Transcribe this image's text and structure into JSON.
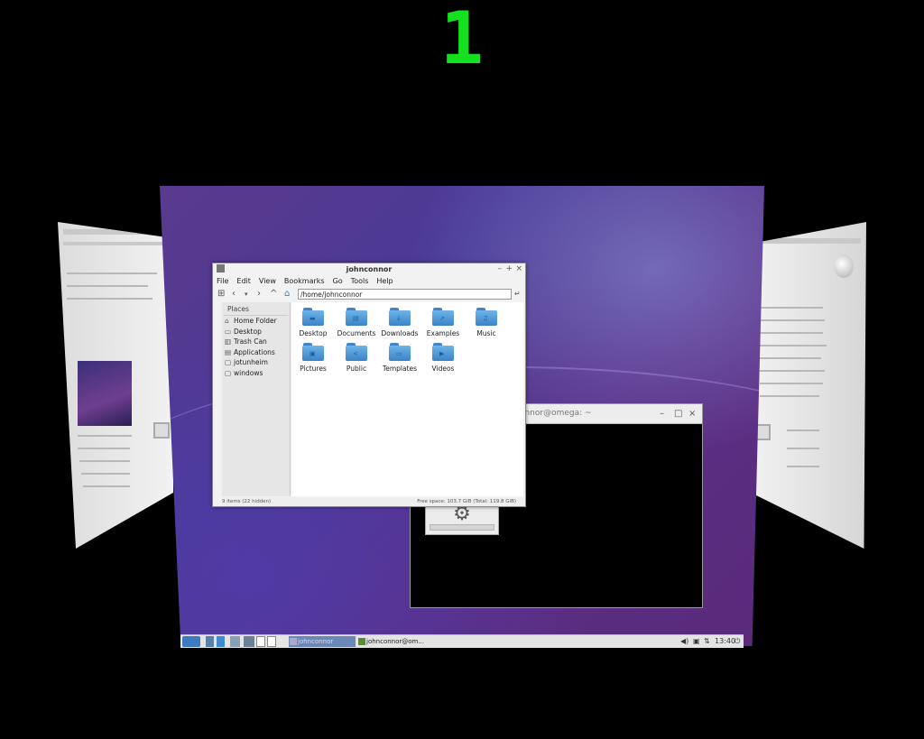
{
  "workspace_number": "1",
  "file_manager": {
    "title": "johnconnor",
    "menu": [
      "File",
      "Edit",
      "View",
      "Bookmarks",
      "Go",
      "Tools",
      "Help"
    ],
    "path": "/home/johnconnor",
    "places_header": "Places",
    "places": [
      {
        "label": "Home Folder",
        "icon": "home-icon"
      },
      {
        "label": "Desktop",
        "icon": "desktop-icon"
      },
      {
        "label": "Trash Can",
        "icon": "trash-icon"
      },
      {
        "label": "Applications",
        "icon": "applications-icon"
      },
      {
        "label": "jotunheim",
        "icon": "drive-icon"
      },
      {
        "label": "windows",
        "icon": "drive-icon"
      }
    ],
    "items": [
      {
        "label": "Desktop",
        "icon": "folder-icon"
      },
      {
        "label": "Documents",
        "icon": "folder-icon"
      },
      {
        "label": "Downloads",
        "icon": "folder-icon"
      },
      {
        "label": "Examples",
        "icon": "folder-icon"
      },
      {
        "label": "Music",
        "icon": "folder-icon"
      },
      {
        "label": "Pictures",
        "icon": "folder-icon"
      },
      {
        "label": "Public",
        "icon": "folder-icon"
      },
      {
        "label": "Templates",
        "icon": "folder-icon"
      },
      {
        "label": "Videos",
        "icon": "folder-icon"
      }
    ],
    "status_left": "9 items (22 hidden)",
    "status_right": "Free space: 103.7 GiB (Total: 119.8 GiB)"
  },
  "terminal": {
    "title": "connor@omega: ~"
  },
  "panel": {
    "task_terminal": "johnconnor@om...",
    "task_filemanager": "johnconnor",
    "clock": "13:40"
  },
  "colors": {
    "workspace_number": "#15e01f",
    "folder": "#3a83c4"
  }
}
